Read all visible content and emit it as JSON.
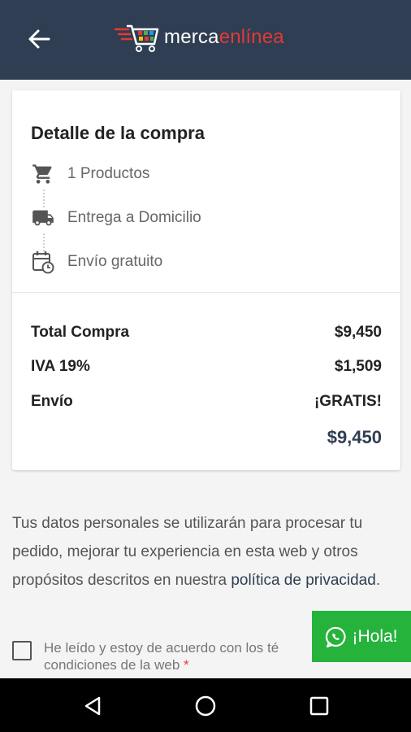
{
  "app": {
    "logo_text_a": "merca",
    "logo_text_b": "enlínea"
  },
  "summary": {
    "title": "Detalle de la compra",
    "steps": [
      {
        "icon": "cart-icon",
        "label": "1 Productos"
      },
      {
        "icon": "truck-icon",
        "label": "Entrega a Domicilio"
      },
      {
        "icon": "calendar-clock-icon",
        "label": "Envío gratuito"
      }
    ],
    "rows": [
      {
        "label": "Total Compra",
        "value": "$9,450"
      },
      {
        "label": "IVA 19%",
        "value": "$1,509"
      },
      {
        "label": "Envío",
        "value": "¡GRATIS!"
      }
    ],
    "grand_total": "$9,450"
  },
  "privacy": {
    "text": "Tus datos personales se utilizarán para procesar tu pedido, mejorar tu experiencia en esta web y otros propósitos descritos en nuestra ",
    "link": "política de privacidad",
    "end": "."
  },
  "terms": {
    "text": "He leído y estoy de acuerdo con los té",
    "text2": "condiciones de la web",
    "required": "*"
  },
  "chat": {
    "label": "¡Hola!"
  },
  "colors": {
    "header": "#2f3e52",
    "accent": "#e53935",
    "chat": "#25b33c"
  }
}
